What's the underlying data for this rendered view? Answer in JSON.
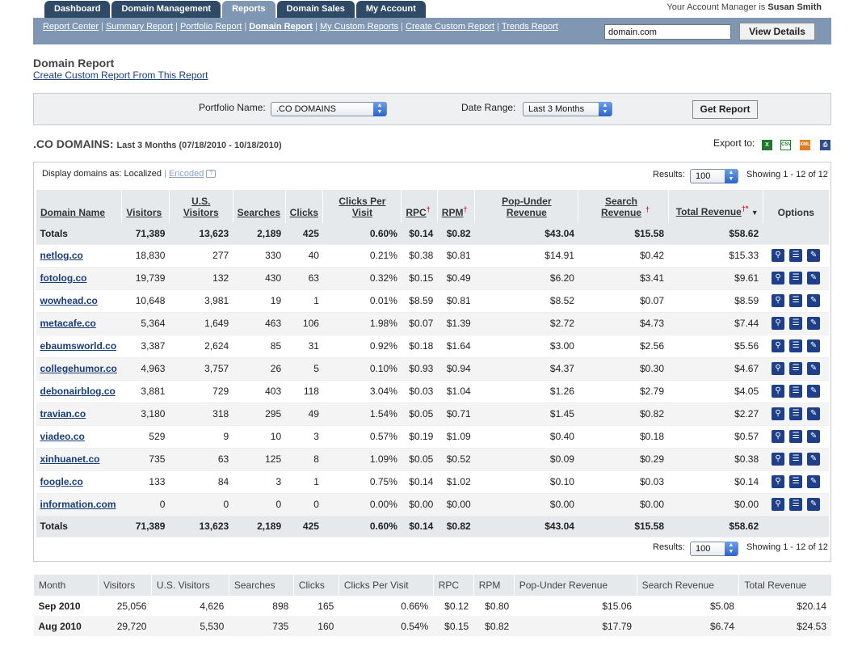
{
  "nav": {
    "tabs": [
      "Dashboard",
      "Domain Management",
      "Reports",
      "Domain Sales",
      "My Account"
    ],
    "active_tab": "Reports",
    "account_prefix": "Your Account Manager is",
    "account_name": "Susan Smith"
  },
  "subnav": {
    "links": [
      "Report Center",
      "Summary Report",
      "Portfolio Report",
      "Domain Report",
      "My Custom Reports",
      "Create Custom Report",
      "Trends Report"
    ],
    "current": "Domain Report",
    "search_value": "domain.com",
    "view_button": "View Details"
  },
  "page": {
    "title": "Domain Report",
    "custom_link": "Create Custom Report From This Report"
  },
  "filters": {
    "portfolio_label": "Portfolio Name:",
    "portfolio_value": ".CO DOMAINS",
    "range_label": "Date Range:",
    "range_value": "Last 3 Months",
    "submit": "Get Report"
  },
  "report": {
    "name": ".CO DOMAINS:",
    "range": "Last 3 Months (07/18/2010 - 10/18/2010)",
    "export_label": "Export to:",
    "export_icons": [
      "excel-icon",
      "csv-icon",
      "xml-icon",
      "print-icon"
    ],
    "display_label": "Display domains as: Localized",
    "display_sep": "|",
    "encoded_link": "Encoded",
    "results_label": "Results:",
    "results_value": "100",
    "showing": "Showing 1 - 12 of 12"
  },
  "table": {
    "headers": [
      "Domain Name",
      "Visitors",
      "U.S. Visitors",
      "Searches",
      "Clicks",
      "Clicks Per Visit",
      "RPC",
      "RPM",
      "Pop-Under Revenue",
      "Search Revenue",
      "Total Revenue",
      "Options"
    ],
    "header_marks": {
      "rpc": "†",
      "rpm": "†",
      "search": "†",
      "total": "†*",
      "sort": "▼"
    },
    "totals_label": "Totals",
    "totals": [
      "71,389",
      "13,623",
      "2,189",
      "425",
      "0.60%",
      "$0.14",
      "$0.82",
      "$43.04",
      "$15.58",
      "$58.62"
    ],
    "rows": [
      [
        "netlog.co",
        "18,830",
        "277",
        "330",
        "40",
        "0.21%",
        "$0.38",
        "$0.81",
        "$14.91",
        "$0.42",
        "$15.33"
      ],
      [
        "fotolog.co",
        "19,739",
        "132",
        "430",
        "63",
        "0.32%",
        "$0.15",
        "$0.49",
        "$6.20",
        "$3.41",
        "$9.61"
      ],
      [
        "wowhead.co",
        "10,648",
        "3,981",
        "19",
        "1",
        "0.01%",
        "$8.59",
        "$0.81",
        "$8.52",
        "$0.07",
        "$8.59"
      ],
      [
        "metacafe.co",
        "5,364",
        "1,649",
        "463",
        "106",
        "1.98%",
        "$0.07",
        "$1.39",
        "$2.72",
        "$4.73",
        "$7.44"
      ],
      [
        "ebaumsworld.co",
        "3,387",
        "2,624",
        "85",
        "31",
        "0.92%",
        "$0.18",
        "$1.64",
        "$3.00",
        "$2.56",
        "$5.56"
      ],
      [
        "collegehumor.co",
        "4,963",
        "3,757",
        "26",
        "5",
        "0.10%",
        "$0.93",
        "$0.94",
        "$4.37",
        "$0.30",
        "$4.67"
      ],
      [
        "debonairblog.co",
        "3,881",
        "729",
        "403",
        "118",
        "3.04%",
        "$0.03",
        "$1.04",
        "$1.26",
        "$2.79",
        "$4.05"
      ],
      [
        "travian.co",
        "3,180",
        "318",
        "295",
        "49",
        "1.54%",
        "$0.05",
        "$0.71",
        "$1.45",
        "$0.82",
        "$2.27"
      ],
      [
        "viadeo.co",
        "529",
        "9",
        "10",
        "3",
        "0.57%",
        "$0.19",
        "$1.09",
        "$0.40",
        "$0.18",
        "$0.57"
      ],
      [
        "xinhuanet.co",
        "735",
        "63",
        "125",
        "8",
        "1.09%",
        "$0.05",
        "$0.52",
        "$0.09",
        "$0.29",
        "$0.38"
      ],
      [
        "foogle.co",
        "133",
        "84",
        "3",
        "1",
        "0.75%",
        "$0.14",
        "$1.02",
        "$0.10",
        "$0.03",
        "$0.14"
      ],
      [
        "information.com",
        "0",
        "0",
        "0",
        "0",
        "0.00%",
        "$0.00",
        "$0.00",
        "$0.00",
        "$0.00",
        "$0.00"
      ]
    ],
    "option_icons": [
      "magnify-icon",
      "list-icon",
      "edit-icon"
    ]
  },
  "monthly": {
    "headers": [
      "Month",
      "Visitors",
      "U.S. Visitors",
      "Searches",
      "Clicks",
      "Clicks Per Visit",
      "RPC",
      "RPM",
      "Pop-Under Revenue",
      "Search Revenue",
      "Total Revenue"
    ],
    "rows": [
      [
        "Sep 2010",
        "25,056",
        "4,626",
        "898",
        "165",
        "0.66%",
        "$0.12",
        "$0.80",
        "$15.06",
        "$5.08",
        "$20.14"
      ],
      [
        "Aug 2010",
        "29,720",
        "5,530",
        "735",
        "160",
        "0.54%",
        "$0.15",
        "$0.82",
        "$17.79",
        "$6.74",
        "$24.53"
      ]
    ]
  }
}
